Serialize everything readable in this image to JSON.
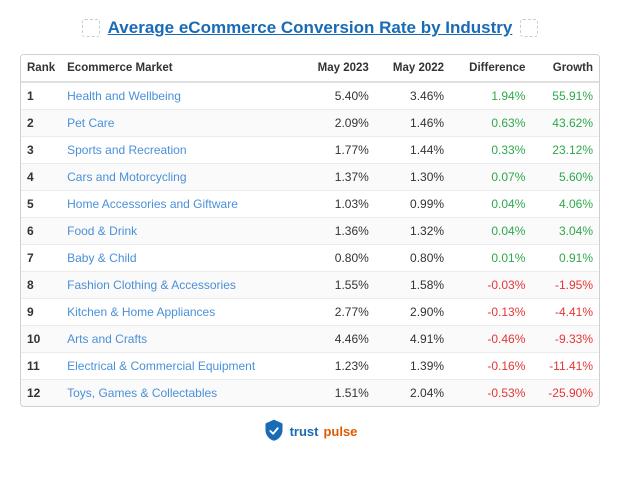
{
  "title": "Average eCommerce Conversion Rate by Industry",
  "columns": {
    "rank": "Rank",
    "market": "Ecommerce Market",
    "may2023": "May 2023",
    "may2022": "May 2022",
    "difference": "Difference",
    "growth": "Growth"
  },
  "rows": [
    {
      "rank": "1",
      "market": "Health and Wellbeing",
      "may2023": "5.40%",
      "may2022": "3.46%",
      "difference": "1.94%",
      "growth": "55.91%",
      "pos": true
    },
    {
      "rank": "2",
      "market": "Pet Care",
      "may2023": "2.09%",
      "may2022": "1.46%",
      "difference": "0.63%",
      "growth": "43.62%",
      "pos": true
    },
    {
      "rank": "3",
      "market": "Sports and Recreation",
      "may2023": "1.77%",
      "may2022": "1.44%",
      "difference": "0.33%",
      "growth": "23.12%",
      "pos": true
    },
    {
      "rank": "4",
      "market": "Cars and Motorcycling",
      "may2023": "1.37%",
      "may2022": "1.30%",
      "difference": "0.07%",
      "growth": "5.60%",
      "pos": true
    },
    {
      "rank": "5",
      "market": "Home Accessories and Giftware",
      "may2023": "1.03%",
      "may2022": "0.99%",
      "difference": "0.04%",
      "growth": "4.06%",
      "pos": true
    },
    {
      "rank": "6",
      "market": "Food & Drink",
      "may2023": "1.36%",
      "may2022": "1.32%",
      "difference": "0.04%",
      "growth": "3.04%",
      "pos": true
    },
    {
      "rank": "7",
      "market": "Baby & Child",
      "may2023": "0.80%",
      "may2022": "0.80%",
      "difference": "0.01%",
      "growth": "0.91%",
      "pos": true
    },
    {
      "rank": "8",
      "market": "Fashion Clothing & Accessories",
      "may2023": "1.55%",
      "may2022": "1.58%",
      "difference": "-0.03%",
      "growth": "-1.95%",
      "pos": false
    },
    {
      "rank": "9",
      "market": "Kitchen & Home Appliances",
      "may2023": "2.77%",
      "may2022": "2.90%",
      "difference": "-0.13%",
      "growth": "-4.41%",
      "pos": false
    },
    {
      "rank": "10",
      "market": "Arts and Crafts",
      "may2023": "4.46%",
      "may2022": "4.91%",
      "difference": "-0.46%",
      "growth": "-9.33%",
      "pos": false
    },
    {
      "rank": "11",
      "market": "Electrical & Commercial Equipment",
      "may2023": "1.23%",
      "may2022": "1.39%",
      "difference": "-0.16%",
      "growth": "-11.41%",
      "pos": false
    },
    {
      "rank": "12",
      "market": "Toys, Games & Collectables",
      "may2023": "1.51%",
      "may2022": "2.04%",
      "difference": "-0.53%",
      "growth": "-25.90%",
      "pos": false
    }
  ],
  "footer": {
    "brand1": "trust",
    "brand2": "pulse"
  }
}
